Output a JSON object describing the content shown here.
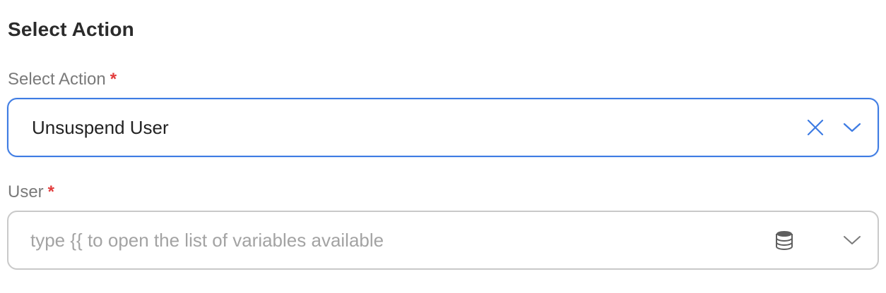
{
  "section": {
    "title": "Select Action"
  },
  "action_field": {
    "label": "Select Action",
    "required_mark": "*",
    "value": "Unsuspend User"
  },
  "user_field": {
    "label": "User",
    "required_mark": "*",
    "placeholder": "type {{ to open the list of variables available"
  },
  "colors": {
    "accent": "#3d7be3",
    "required": "#e23b3b",
    "label": "#7a7a7a",
    "placeholder": "#a3a3a3"
  },
  "icons": {
    "clear": "close-icon",
    "dropdown": "chevron-down-icon",
    "variables": "database-icon"
  }
}
